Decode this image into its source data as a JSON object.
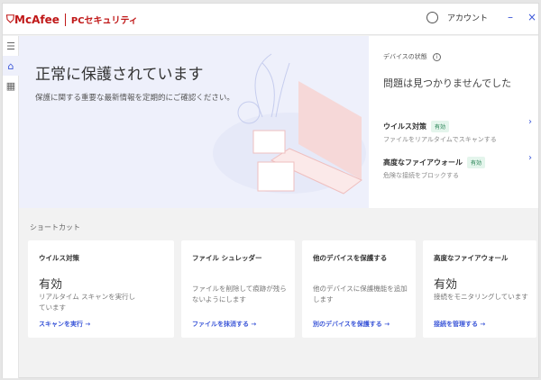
{
  "header": {
    "brand": "McAfee",
    "product": "PCセキュリティ",
    "account": "アカウント",
    "minimize": "–",
    "close": "×"
  },
  "sidebar": {
    "menu": "☰",
    "home": "⌂",
    "apps": "▦"
  },
  "hero": {
    "title": "正常に保護されています",
    "subtitle": "保護に関する重要な最新情報を定期的にご確認ください。"
  },
  "status": {
    "title": "デバイスの状態",
    "info": "i",
    "headline": "問題は見つかりませんでした",
    "items": [
      {
        "name": "ウイルス対策",
        "badge": "有効",
        "desc": "ファイルをリアルタイムでスキャンする"
      },
      {
        "name": "高度なファイアウォール",
        "badge": "有効",
        "desc": "危険な接続をブロックする"
      }
    ]
  },
  "shortcuts": {
    "title": "ショートカット",
    "cards": [
      {
        "title": "ウイルス対策",
        "status": "有効",
        "desc": "リアルタイム スキャンを実行しています",
        "link": "スキャンを実行 →"
      },
      {
        "title": "ファイル シュレッダー",
        "desc": "ファイルを削除して痕跡が残らないようにします",
        "link": "ファイルを抹消する →"
      },
      {
        "title": "他のデバイスを保護する",
        "desc": "他のデバイスに保護機能を追加します",
        "link": "別のデバイスを保護する →"
      },
      {
        "title": "高度なファイアウォール",
        "status": "有効",
        "desc": "接続をモニタリングしています",
        "link": "接続を管理する →"
      }
    ]
  }
}
